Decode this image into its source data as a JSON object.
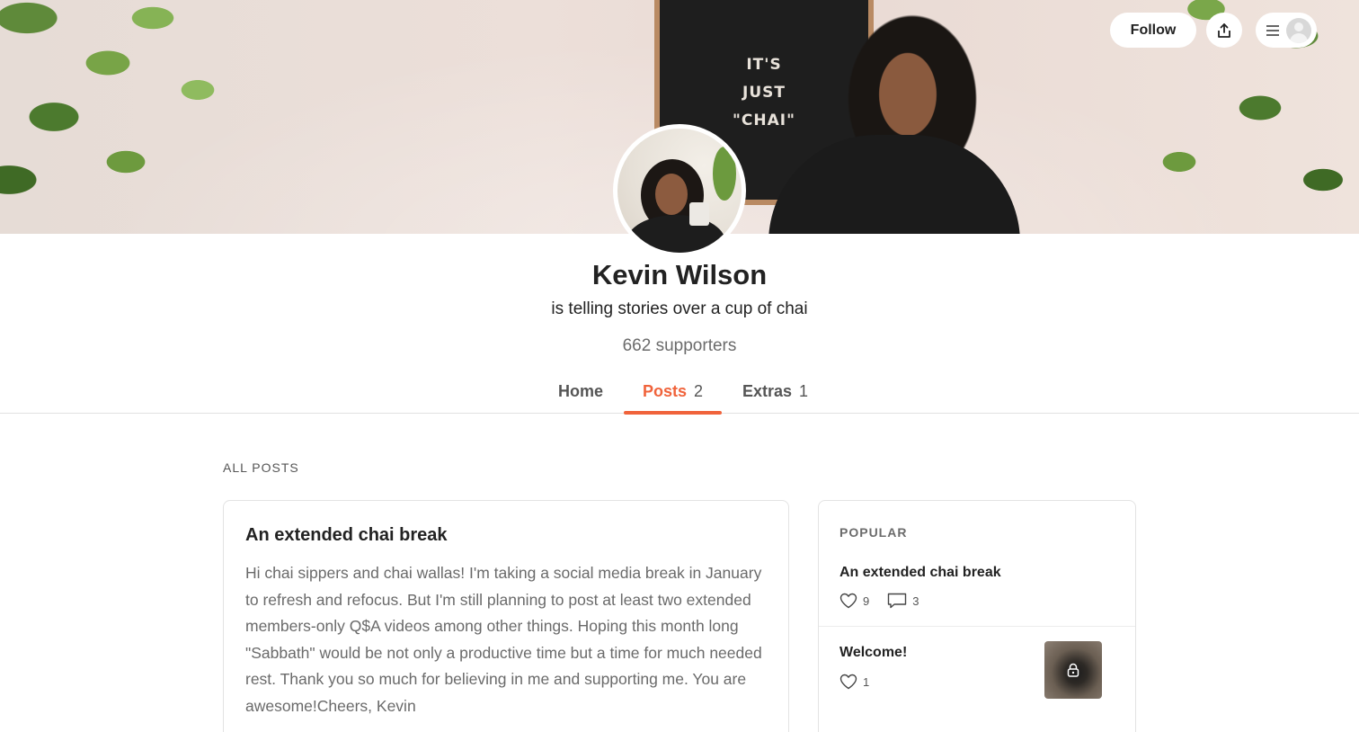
{
  "header": {
    "cover_board_lines": [
      "IT'S",
      "JUST",
      "\"CHAI\""
    ],
    "follow_label": "Follow",
    "share_icon": "share-icon",
    "menu_icon": "hamburger-menu-icon",
    "user_icon": "user-avatar-icon"
  },
  "profile": {
    "name": "Kevin Wilson",
    "tagline": "is telling stories over a cup of chai",
    "supporters_count": "662",
    "supporters_label": "supporters"
  },
  "tabs": [
    {
      "label": "Home",
      "count": ""
    },
    {
      "label": "Posts",
      "count": "2",
      "active": true
    },
    {
      "label": "Extras",
      "count": "1"
    }
  ],
  "posts_section": {
    "label": "ALL POSTS",
    "posts": [
      {
        "title": "An extended chai break",
        "body": "Hi chai sippers and chai wallas! I'm taking a social media break in January to refresh and refocus. But I'm still planning to post at least two extended members-only Q$A videos among other things. Hoping this month long \"Sabbath\" would be not only a productive time but a time for much needed rest. Thank you so much for believing in me and supporting me. You are awesome!Cheers, Kevin"
      }
    ]
  },
  "popular": {
    "label": "POPULAR",
    "items": [
      {
        "title": "An extended chai break",
        "likes": "9",
        "comments": "3"
      },
      {
        "title": "Welcome!",
        "likes": "1",
        "locked": true
      }
    ]
  },
  "colors": {
    "accent": "#f0633b",
    "text": "#222222",
    "muted": "#6b6b6b",
    "border": "#e3e3e3"
  }
}
